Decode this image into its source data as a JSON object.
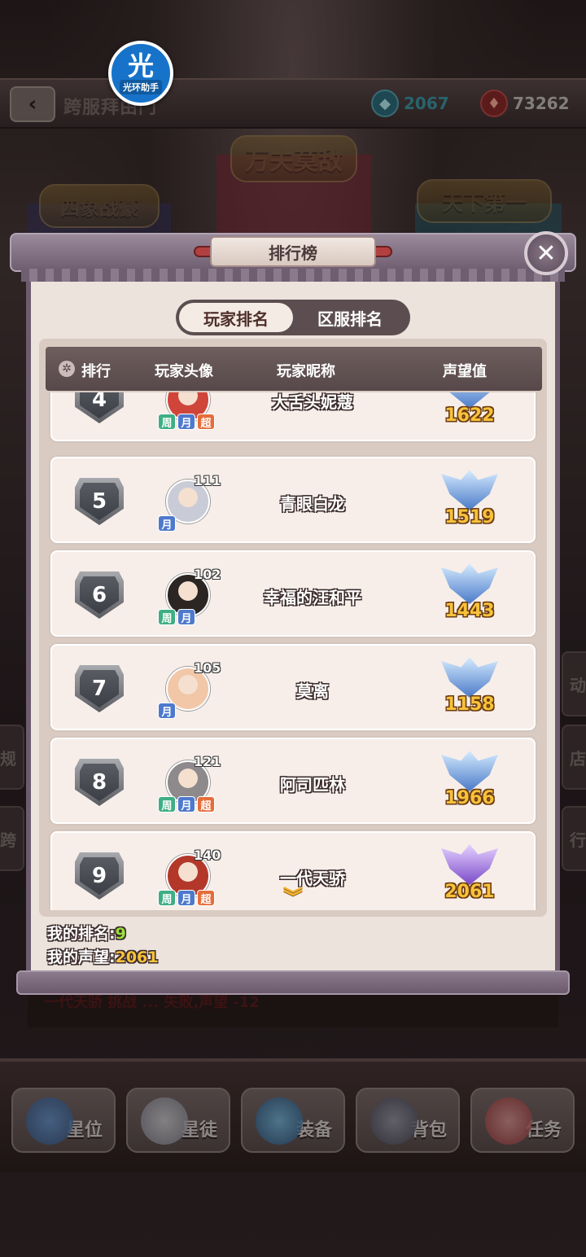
{
  "header": {
    "page_title": "跨服拜由门",
    "currency_1": {
      "icon": "crystal-icon",
      "value": "2067"
    },
    "currency_2": {
      "icon": "ruby-icon",
      "value": "73262"
    }
  },
  "helper_badge": {
    "glyph": "光",
    "label": "光环助手"
  },
  "banners": [
    "四象战豪",
    "万夫莫敌",
    "天下第一"
  ],
  "side_buttons": {
    "left": [
      "规",
      "跨"
    ],
    "right": [
      "动",
      "店",
      "行"
    ]
  },
  "leaderboard": {
    "title": "排行榜",
    "tabs": [
      {
        "label": "玩家排名",
        "active": true
      },
      {
        "label": "区服排名",
        "active": false
      }
    ],
    "columns": {
      "rank": "排行",
      "avatar": "玩家头像",
      "nickname": "玩家昵称",
      "prestige": "声望值"
    },
    "rows": [
      {
        "rank": "4",
        "level": "",
        "tags": [
          "周",
          "月",
          "超"
        ],
        "name": "大舌头妮蔻",
        "prestige": "1622",
        "crest": "blue",
        "avatar_color": "#d0453a"
      },
      {
        "rank": "5",
        "level": "111",
        "tags": [
          "月"
        ],
        "name": "青眼白龙",
        "prestige": "1519",
        "crest": "blue",
        "avatar_color": "#c9ccd6"
      },
      {
        "rank": "6",
        "level": "102",
        "tags": [
          "周",
          "月"
        ],
        "name": "幸福的汪和平",
        "prestige": "1443",
        "crest": "blue",
        "avatar_color": "#2b2624"
      },
      {
        "rank": "7",
        "level": "105",
        "tags": [
          "月"
        ],
        "name": "莫离",
        "prestige": "1158",
        "crest": "blue",
        "avatar_color": "#f1c7a8"
      },
      {
        "rank": "8",
        "level": "121",
        "tags": [
          "周",
          "月",
          "超"
        ],
        "name": "阿司匹林",
        "prestige": "1966",
        "crest": "blue",
        "avatar_color": "#8e8a8c"
      },
      {
        "rank": "9",
        "level": "140",
        "tags": [
          "周",
          "月",
          "超"
        ],
        "name": "一代天骄",
        "prestige": "2061",
        "crest": "purple",
        "avatar_color": "#b3382a"
      }
    ],
    "my_rank_label": "我的排名:",
    "my_rank_value": "9",
    "my_prestige_label": "我的声望:",
    "my_prestige_value": "2061"
  },
  "log_text": "一代天骄 挑战 ... 失败,声望 -12",
  "bottom_nav": [
    {
      "label": "星位",
      "icon": "star-position-icon"
    },
    {
      "label": "星徒",
      "icon": "disciple-icon"
    },
    {
      "label": "装备",
      "icon": "equipment-icon"
    },
    {
      "label": "背包",
      "icon": "backpack-icon"
    },
    {
      "label": "任务",
      "icon": "quest-icon"
    }
  ],
  "colors": {
    "prestige": "#f7c23a",
    "my_rank": "#9be03a",
    "tag_week": "#3fae84",
    "tag_month": "#4f79cc",
    "tag_super": "#e56d3a"
  }
}
